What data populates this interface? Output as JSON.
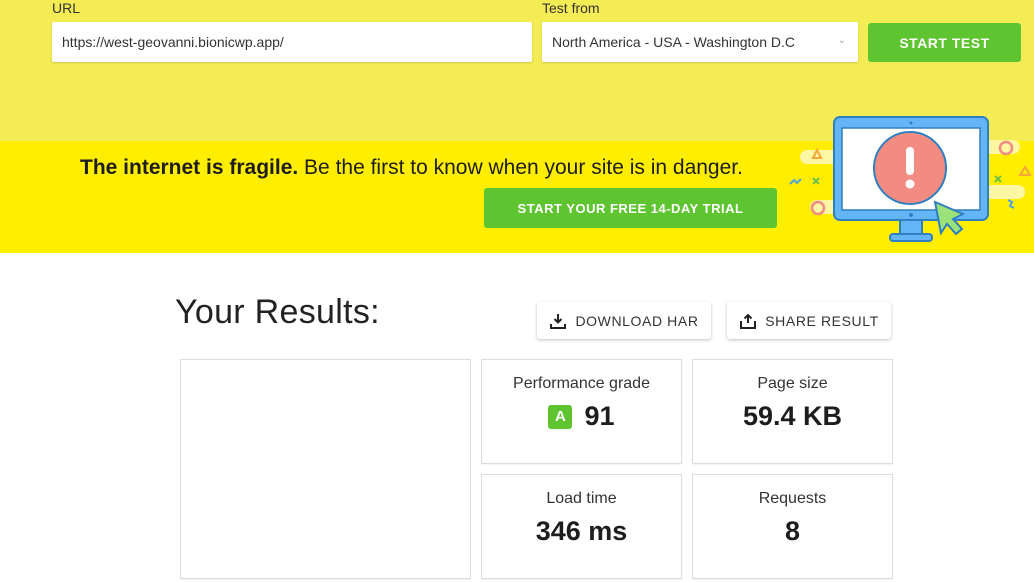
{
  "form": {
    "url_label": "URL",
    "url_value": "https://west-geovanni.bionicwp.app/",
    "location_label": "Test from",
    "location_value": "North America - USA - Washington D.C",
    "start_button": "START TEST"
  },
  "banner": {
    "bold_text": "The internet is fragile.",
    "text": " Be the first to know when your site is in danger.",
    "trial_button": "START YOUR FREE 14-DAY TRIAL",
    "illustration": "monitor-alert-illustration"
  },
  "results": {
    "title": "Your Results:",
    "download_button": "DOWNLOAD HAR",
    "share_button": "SHARE RESULT",
    "performance": {
      "label": "Performance grade",
      "grade": "A",
      "score": "91"
    },
    "page_size": {
      "label": "Page size",
      "value": "59.4 KB"
    },
    "load_time": {
      "label": "Load time",
      "value": "346 ms"
    },
    "requests": {
      "label": "Requests",
      "value": "8"
    }
  },
  "colors": {
    "accent_green": "#5ec42f",
    "banner_yellow": "#ffee00",
    "top_yellow": "#f4ec55"
  }
}
